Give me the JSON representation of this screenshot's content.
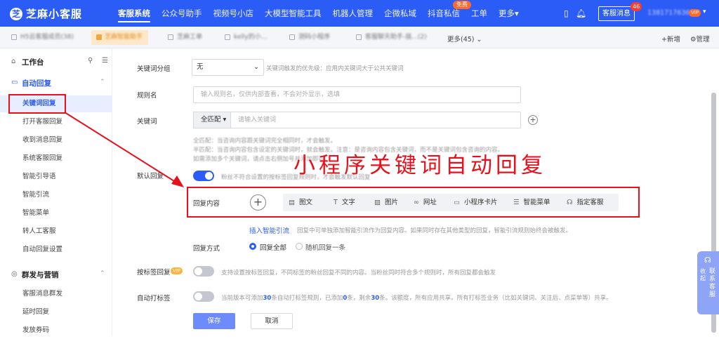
{
  "app": {
    "logo": "芝麻小客服",
    "logo_mark": "芝"
  },
  "topnav": [
    {
      "label": "客服系统",
      "active": true
    },
    {
      "label": "公众号助手"
    },
    {
      "label": "视频号小店"
    },
    {
      "label": "大模型智能工具"
    },
    {
      "label": "机器人管理"
    },
    {
      "label": "企微私域"
    },
    {
      "label": "抖音私信",
      "badge": "免费"
    },
    {
      "label": "工单"
    },
    {
      "label": "更多▾"
    }
  ],
  "topbar": {
    "service_btn": "客服消息",
    "msg_count": "46",
    "user_phone": "13817176369",
    "vip": "VIP"
  },
  "tabs": [
    {
      "label": "H5云客服成员(38)"
    },
    {
      "label": "芝麻智能助手"
    },
    {
      "label": "芝麻工单"
    },
    {
      "label": "kelly的小..."
    },
    {
      "label": "测码小程序"
    },
    {
      "label": "客服聊天助手-搞...(2)"
    }
  ],
  "tab_more": "更多(45)",
  "tab_actions": {
    "add": "+新增",
    "manage": "管理"
  },
  "sidebar": {
    "workbench": "工作台",
    "auto_reply": "自动回复",
    "auto_items": [
      "关键词回复",
      "打开客服回复",
      "收到消息回复",
      "系统客服回复",
      "智能引导语",
      "智能引流",
      "智能菜单",
      "转人工客服",
      "自动回复设置"
    ],
    "group_marketing": "群发与营销",
    "group_items": [
      "客服消息群发",
      "延时回复",
      "发放券码"
    ]
  },
  "form": {
    "keyword_group_label": "关键词分组",
    "keyword_group_value": "无",
    "keyword_group_hint": "关键词触发的优先级：应用内关键词大于公共关键词",
    "rule_name_label": "规则名",
    "rule_name_placeholder": "输入规则名，仅供内部查看，不会对外显示，选填",
    "keyword_label": "关键词",
    "match_mode": "全匹配",
    "keyword_placeholder": "请输入关键词",
    "help_1": "全匹配：当咨询内容跟关键词完全相同时，才会触发。",
    "help_2": "半匹配：当咨询内容包含设定的关键词时，就会触发。注意：是咨询内容包含关键词，而不是关键词包含咨询的内容。",
    "help_3": "如需添加多个关键词，请点击右侧加号并添加即可。",
    "default_reply_label": "默认回复",
    "default_reply_hint": "粉丝不符合设置的按标签回复规则时，才会触发默认回复",
    "reply_content_label": "回复内容",
    "reply_types": [
      "图文",
      "文字",
      "图片",
      "网址",
      "小程序卡片",
      "智能菜单",
      "指定客服"
    ],
    "insert_link": "插入智能引流",
    "insert_hint": "回复中可单独添加智能引流作为回复内容。如果同时存在其他类型的回复，智能引流规则始终会被触发。",
    "reply_mode_label": "回复方式",
    "reply_mode_all": "回复全部",
    "reply_mode_random": "随机回复一条",
    "tag_reply_label": "按标签回复",
    "tag_reply_hint": "支持设置按标签回复，不同标签的粉丝回复不同的内容。当粉丝同时符合多个规则时，所有回复都会触发",
    "auto_tag_label": "自动打标签",
    "auto_tag_hint_a": "当前版本可添加",
    "auto_tag_n1": "30",
    "auto_tag_hint_b": "条自动打标签规则，已添加",
    "auto_tag_n2": "0",
    "auto_tag_hint_c": "条，剩余",
    "auto_tag_n3": "30",
    "auto_tag_hint_d": "条。该额度，所有应用共享。所有打标签业务（比如关键词、关注后、点菜单等）共享。",
    "save": "保存",
    "cancel": "取消"
  },
  "overlay_title": "小程序关键词自动回复",
  "contact": {
    "collapse": "收起",
    "contact": "联系客服"
  },
  "colors": {
    "brand": "#2b5cf6",
    "annotation": "#e8101a"
  }
}
